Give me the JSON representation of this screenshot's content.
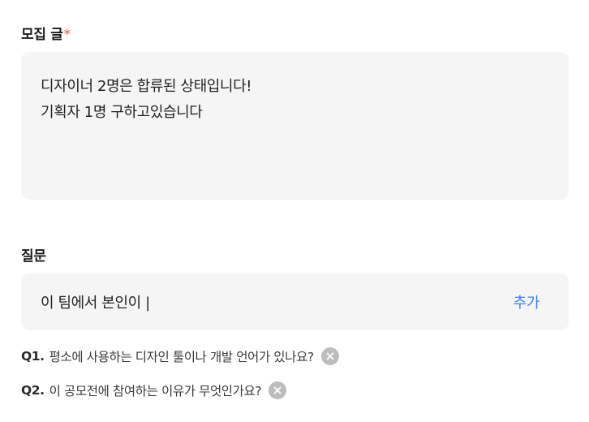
{
  "post": {
    "label": "모집 글",
    "required_mark": "*",
    "lines": [
      "디자이너 2명은 합류된 상태입니다!",
      "기획자 1명 구하고있습니다"
    ]
  },
  "questions": {
    "label": "질문",
    "input_value": "이 팀에서 본인이 |",
    "add_label": "추가",
    "items": [
      {
        "num": "Q1.",
        "text": "평소에 사용하는 디자인 툴이나 개발 언어가 있나요?"
      },
      {
        "num": "Q2.",
        "text": "이 공모전에 참여하는 이유가 무엇인가요?"
      }
    ]
  },
  "colors": {
    "accent": "#3d7ff0",
    "required": "#ff4d4f",
    "field_bg": "#f5f5f5",
    "remove_icon_bg": "#bdbdbd"
  },
  "icons": {
    "remove": "close-circle-icon"
  }
}
